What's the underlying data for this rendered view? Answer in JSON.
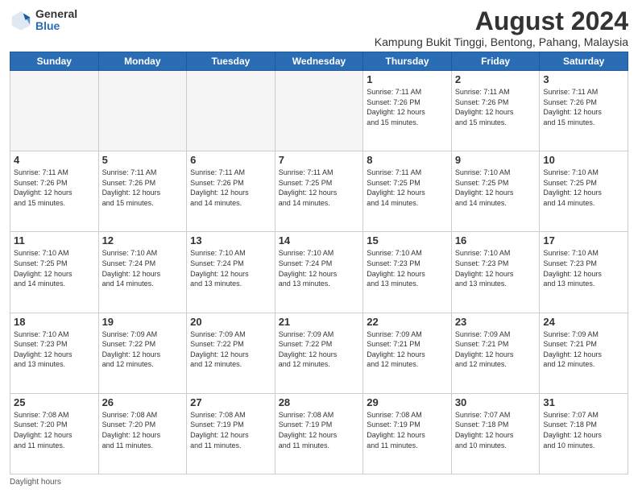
{
  "logo": {
    "general": "General",
    "blue": "Blue"
  },
  "title": "August 2024",
  "location": "Kampung Bukit Tinggi, Bentong, Pahang, Malaysia",
  "days_of_week": [
    "Sunday",
    "Monday",
    "Tuesday",
    "Wednesday",
    "Thursday",
    "Friday",
    "Saturday"
  ],
  "footer": "Daylight hours",
  "weeks": [
    [
      {
        "day": "",
        "info": ""
      },
      {
        "day": "",
        "info": ""
      },
      {
        "day": "",
        "info": ""
      },
      {
        "day": "",
        "info": ""
      },
      {
        "day": "1",
        "info": "Sunrise: 7:11 AM\nSunset: 7:26 PM\nDaylight: 12 hours\nand 15 minutes."
      },
      {
        "day": "2",
        "info": "Sunrise: 7:11 AM\nSunset: 7:26 PM\nDaylight: 12 hours\nand 15 minutes."
      },
      {
        "day": "3",
        "info": "Sunrise: 7:11 AM\nSunset: 7:26 PM\nDaylight: 12 hours\nand 15 minutes."
      }
    ],
    [
      {
        "day": "4",
        "info": "Sunrise: 7:11 AM\nSunset: 7:26 PM\nDaylight: 12 hours\nand 15 minutes."
      },
      {
        "day": "5",
        "info": "Sunrise: 7:11 AM\nSunset: 7:26 PM\nDaylight: 12 hours\nand 15 minutes."
      },
      {
        "day": "6",
        "info": "Sunrise: 7:11 AM\nSunset: 7:26 PM\nDaylight: 12 hours\nand 14 minutes."
      },
      {
        "day": "7",
        "info": "Sunrise: 7:11 AM\nSunset: 7:25 PM\nDaylight: 12 hours\nand 14 minutes."
      },
      {
        "day": "8",
        "info": "Sunrise: 7:11 AM\nSunset: 7:25 PM\nDaylight: 12 hours\nand 14 minutes."
      },
      {
        "day": "9",
        "info": "Sunrise: 7:10 AM\nSunset: 7:25 PM\nDaylight: 12 hours\nand 14 minutes."
      },
      {
        "day": "10",
        "info": "Sunrise: 7:10 AM\nSunset: 7:25 PM\nDaylight: 12 hours\nand 14 minutes."
      }
    ],
    [
      {
        "day": "11",
        "info": "Sunrise: 7:10 AM\nSunset: 7:25 PM\nDaylight: 12 hours\nand 14 minutes."
      },
      {
        "day": "12",
        "info": "Sunrise: 7:10 AM\nSunset: 7:24 PM\nDaylight: 12 hours\nand 14 minutes."
      },
      {
        "day": "13",
        "info": "Sunrise: 7:10 AM\nSunset: 7:24 PM\nDaylight: 12 hours\nand 13 minutes."
      },
      {
        "day": "14",
        "info": "Sunrise: 7:10 AM\nSunset: 7:24 PM\nDaylight: 12 hours\nand 13 minutes."
      },
      {
        "day": "15",
        "info": "Sunrise: 7:10 AM\nSunset: 7:23 PM\nDaylight: 12 hours\nand 13 minutes."
      },
      {
        "day": "16",
        "info": "Sunrise: 7:10 AM\nSunset: 7:23 PM\nDaylight: 12 hours\nand 13 minutes."
      },
      {
        "day": "17",
        "info": "Sunrise: 7:10 AM\nSunset: 7:23 PM\nDaylight: 12 hours\nand 13 minutes."
      }
    ],
    [
      {
        "day": "18",
        "info": "Sunrise: 7:10 AM\nSunset: 7:23 PM\nDaylight: 12 hours\nand 13 minutes."
      },
      {
        "day": "19",
        "info": "Sunrise: 7:09 AM\nSunset: 7:22 PM\nDaylight: 12 hours\nand 12 minutes."
      },
      {
        "day": "20",
        "info": "Sunrise: 7:09 AM\nSunset: 7:22 PM\nDaylight: 12 hours\nand 12 minutes."
      },
      {
        "day": "21",
        "info": "Sunrise: 7:09 AM\nSunset: 7:22 PM\nDaylight: 12 hours\nand 12 minutes."
      },
      {
        "day": "22",
        "info": "Sunrise: 7:09 AM\nSunset: 7:21 PM\nDaylight: 12 hours\nand 12 minutes."
      },
      {
        "day": "23",
        "info": "Sunrise: 7:09 AM\nSunset: 7:21 PM\nDaylight: 12 hours\nand 12 minutes."
      },
      {
        "day": "24",
        "info": "Sunrise: 7:09 AM\nSunset: 7:21 PM\nDaylight: 12 hours\nand 12 minutes."
      }
    ],
    [
      {
        "day": "25",
        "info": "Sunrise: 7:08 AM\nSunset: 7:20 PM\nDaylight: 12 hours\nand 11 minutes."
      },
      {
        "day": "26",
        "info": "Sunrise: 7:08 AM\nSunset: 7:20 PM\nDaylight: 12 hours\nand 11 minutes."
      },
      {
        "day": "27",
        "info": "Sunrise: 7:08 AM\nSunset: 7:19 PM\nDaylight: 12 hours\nand 11 minutes."
      },
      {
        "day": "28",
        "info": "Sunrise: 7:08 AM\nSunset: 7:19 PM\nDaylight: 12 hours\nand 11 minutes."
      },
      {
        "day": "29",
        "info": "Sunrise: 7:08 AM\nSunset: 7:19 PM\nDaylight: 12 hours\nand 11 minutes."
      },
      {
        "day": "30",
        "info": "Sunrise: 7:07 AM\nSunset: 7:18 PM\nDaylight: 12 hours\nand 10 minutes."
      },
      {
        "day": "31",
        "info": "Sunrise: 7:07 AM\nSunset: 7:18 PM\nDaylight: 12 hours\nand 10 minutes."
      }
    ]
  ]
}
